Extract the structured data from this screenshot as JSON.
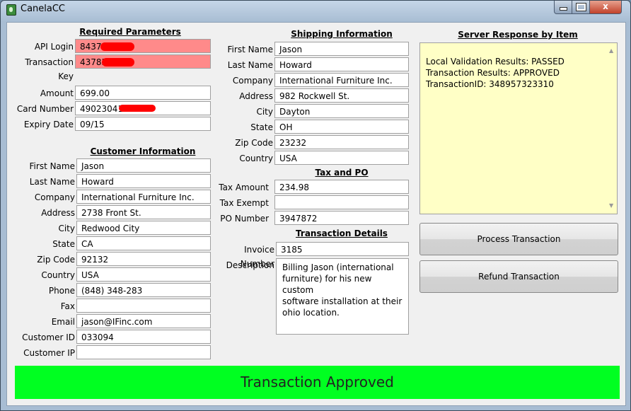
{
  "window": {
    "title": "CanelaCC",
    "close_glyph": "x"
  },
  "required": {
    "header": "Required Parameters",
    "api_login": {
      "label": "API Login",
      "value": "84375"
    },
    "transaction_key": {
      "label": "Transaction Key",
      "value": "43785"
    },
    "amount": {
      "label": "Amount",
      "value": "699.00"
    },
    "card_number": {
      "label": "Card Number",
      "value": "490230411"
    },
    "expiry_date": {
      "label": "Expiry Date",
      "value": "09/15"
    }
  },
  "customer": {
    "header": "Customer Information",
    "first_name": {
      "label": "First Name",
      "value": "Jason"
    },
    "last_name": {
      "label": "Last Name",
      "value": "Howard"
    },
    "company": {
      "label": "Company",
      "value": "International Furniture Inc."
    },
    "address": {
      "label": "Address",
      "value": "2738 Front St."
    },
    "city": {
      "label": "City",
      "value": "Redwood City"
    },
    "state": {
      "label": "State",
      "value": "CA"
    },
    "zip": {
      "label": "Zip Code",
      "value": "92132"
    },
    "country": {
      "label": "Country",
      "value": "USA"
    },
    "phone": {
      "label": "Phone",
      "value": "(848) 348-283"
    },
    "fax": {
      "label": "Fax",
      "value": ""
    },
    "email": {
      "label": "Email",
      "value": "jason@IFinc.com"
    },
    "customer_id": {
      "label": "Customer ID",
      "value": "033094"
    },
    "customer_ip": {
      "label": "Customer IP",
      "value": ""
    }
  },
  "shipping": {
    "header": "Shipping Information",
    "first_name": {
      "label": "First Name",
      "value": "Jason"
    },
    "last_name": {
      "label": "Last Name",
      "value": "Howard"
    },
    "company": {
      "label": "Company",
      "value": "International Furniture Inc."
    },
    "address": {
      "label": "Address",
      "value": "982 Rockwell St."
    },
    "city": {
      "label": "City",
      "value": "Dayton"
    },
    "state": {
      "label": "State",
      "value": "OH"
    },
    "zip": {
      "label": "Zip Code",
      "value": "23232"
    },
    "country": {
      "label": "Country",
      "value": "USA"
    }
  },
  "tax": {
    "header": "Tax and PO",
    "tax_amount": {
      "label": "Tax Amount",
      "value": "234.98"
    },
    "tax_exempt": {
      "label": "Tax Exempt",
      "value": ""
    },
    "po_number": {
      "label": "PO Number",
      "value": "3947872"
    }
  },
  "details": {
    "header": "Transaction Details",
    "invoice_number": {
      "label": "Invoice Number",
      "value": "3185"
    },
    "description": {
      "label": "Description",
      "value": "Billing Jason (international\nfurniture) for his new custom\nsoftware installation at their\nohio location."
    }
  },
  "server": {
    "header": "Server Response by Item",
    "lines": [
      "Local Validation Results: PASSED",
      "Transaction Results: APPROVED",
      "TransactionID: 348957323310"
    ]
  },
  "buttons": {
    "process": "Process Transaction",
    "refund": "Refund Transaction"
  },
  "status": {
    "text": "Transaction Approved",
    "color": "#00ff21"
  },
  "colors": {
    "required_field": "#ff8a8a",
    "redaction": "#ff0000",
    "response_bg": "#ffffc6"
  }
}
